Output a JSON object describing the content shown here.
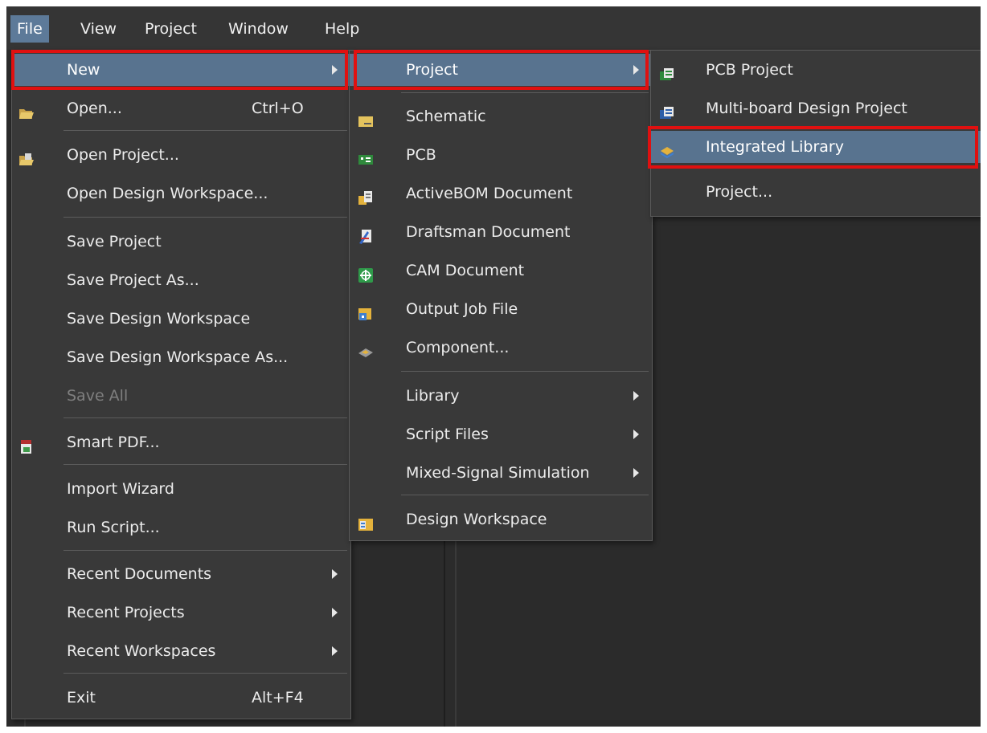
{
  "menubar": {
    "items": [
      {
        "label": "File",
        "active": true
      },
      {
        "label": "View",
        "active": false
      },
      {
        "label": "Project",
        "active": false
      },
      {
        "label": "Window",
        "active": false
      },
      {
        "label": "Help",
        "active": false
      }
    ]
  },
  "file_menu": {
    "items": [
      {
        "label": "New",
        "has_submenu": true,
        "highlighted": true
      },
      {
        "label": "Open...",
        "shortcut": "Ctrl+O",
        "icon": "folder-open-icon"
      },
      {
        "label": "Open Project...",
        "icon": "open-project-icon"
      },
      {
        "label": "Open Design Workspace..."
      },
      {
        "label": "Save Project"
      },
      {
        "label": "Save Project As..."
      },
      {
        "label": "Save Design Workspace"
      },
      {
        "label": "Save Design Workspace As..."
      },
      {
        "label": "Save All",
        "disabled": true
      },
      {
        "label": "Smart PDF...",
        "icon": "pdf-icon"
      },
      {
        "label": "Import Wizard"
      },
      {
        "label": "Run Script..."
      },
      {
        "label": "Recent Documents",
        "has_submenu": true
      },
      {
        "label": "Recent Projects",
        "has_submenu": true
      },
      {
        "label": "Recent Workspaces",
        "has_submenu": true
      },
      {
        "label": "Exit",
        "shortcut": "Alt+F4"
      }
    ]
  },
  "new_menu": {
    "items": [
      {
        "label": "Project",
        "has_submenu": true,
        "highlighted": true
      },
      {
        "label": "Schematic",
        "icon": "schematic-icon"
      },
      {
        "label": "PCB",
        "icon": "pcb-icon"
      },
      {
        "label": "ActiveBOM Document",
        "icon": "bom-icon"
      },
      {
        "label": "Draftsman Document",
        "icon": "draftsman-icon"
      },
      {
        "label": "CAM Document",
        "icon": "cam-icon"
      },
      {
        "label": "Output Job File",
        "icon": "output-job-icon"
      },
      {
        "label": "Component...",
        "icon": "component-icon"
      },
      {
        "label": "Library",
        "has_submenu": true
      },
      {
        "label": "Script Files",
        "has_submenu": true
      },
      {
        "label": "Mixed-Signal Simulation",
        "has_submenu": true
      },
      {
        "label": "Design Workspace",
        "icon": "workspace-icon"
      }
    ]
  },
  "project_menu": {
    "items": [
      {
        "label": "PCB Project",
        "icon": "pcb-project-icon"
      },
      {
        "label": "Multi-board Design Project",
        "icon": "multiboard-icon"
      },
      {
        "label": "Integrated Library",
        "icon": "integrated-library-icon",
        "highlighted": true
      },
      {
        "label": "Project..."
      }
    ]
  },
  "colors": {
    "highlight": "#58738f",
    "menu_bg": "#393939",
    "annotation_red": "#e01010"
  }
}
